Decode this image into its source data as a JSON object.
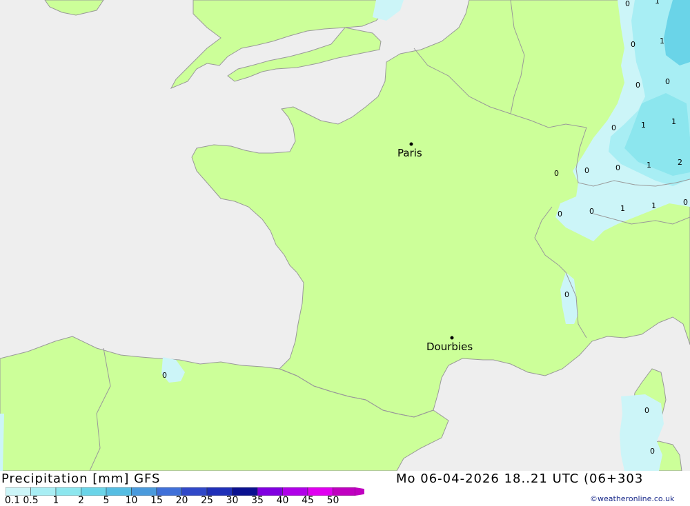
{
  "map": {
    "cities": [
      {
        "name": "Paris"
      },
      {
        "name": "Dourbies"
      }
    ],
    "precip_labels": [
      "0",
      "1",
      "0",
      "1",
      "0",
      "0",
      "0",
      "1",
      "1",
      "0",
      "0",
      "0",
      "1",
      "2",
      "0",
      "0",
      "1",
      "1",
      "0",
      "0",
      "0",
      "0",
      "0"
    ]
  },
  "footer": {
    "title": "Precipitation [mm] GFS",
    "valid": "Mo 06-04-2026 18..21 UTC (06+303",
    "credit": "©weatheronline.co.uk"
  },
  "legend": {
    "labels": [
      "0.1",
      "0.5",
      "1",
      "2",
      "5",
      "10",
      "15",
      "20",
      "25",
      "30",
      "35",
      "40",
      "45",
      "50"
    ],
    "colors": [
      "#ccf5f8",
      "#a8eef4",
      "#8ce6ee",
      "#6ad4e8",
      "#56bde2",
      "#4a9adc",
      "#4070d8",
      "#3048c8",
      "#2030b8",
      "#0a1090",
      "#8000e0",
      "#b000e8",
      "#e000f0",
      "#c000c0"
    ]
  },
  "colors": {
    "land": "#ccff99",
    "sea": "#eeeeee",
    "border": "#999999",
    "rain_light": "#ccf5f8",
    "rain_mid": "#a8eef4",
    "rain_heavy": "#6ad4e8"
  }
}
